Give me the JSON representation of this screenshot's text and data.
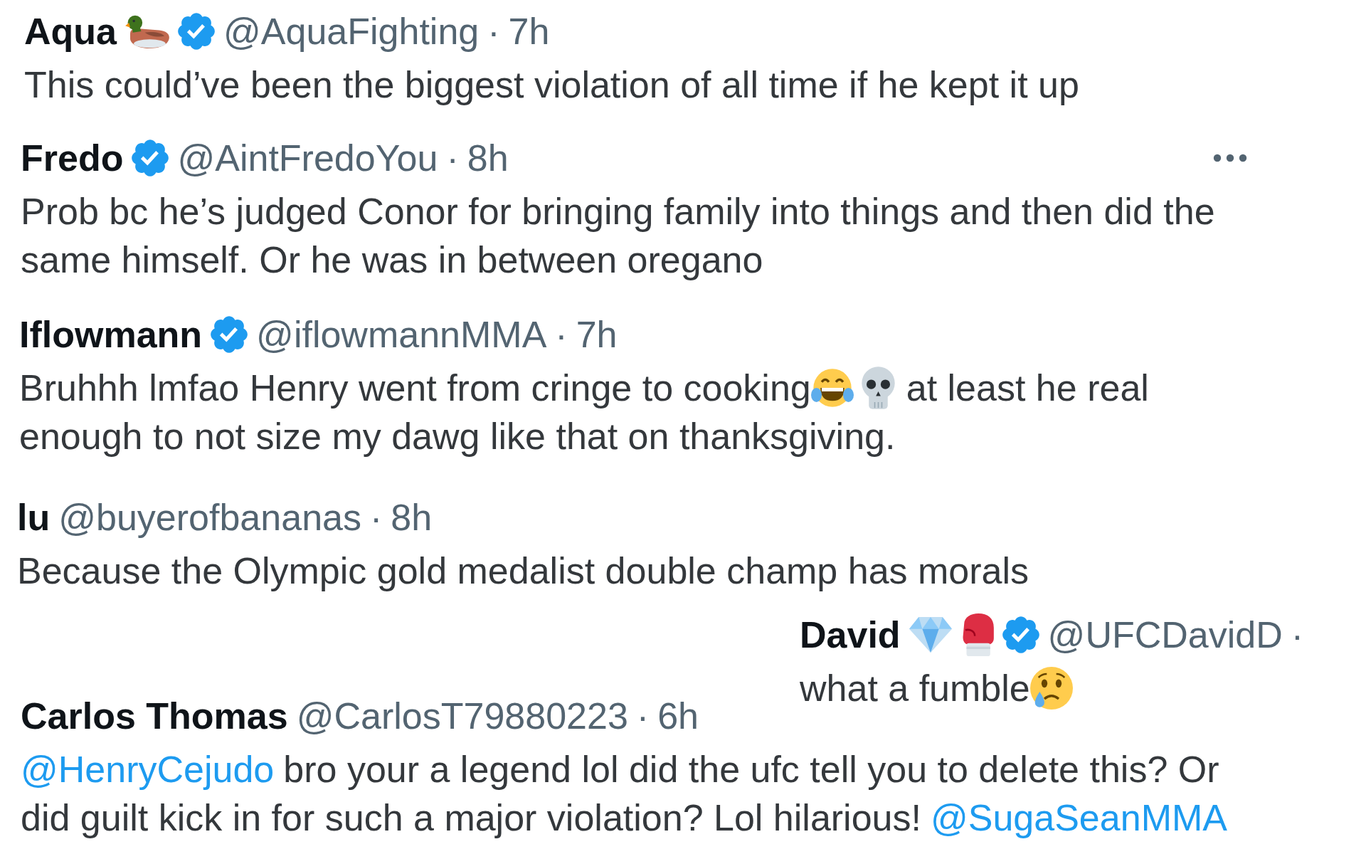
{
  "tweets": [
    {
      "name": "Aqua",
      "name_icons": [
        {
          "kind": "duck"
        }
      ],
      "verified": true,
      "handle": "@AquaFighting",
      "separator": "·",
      "time": "7h",
      "more_button": false,
      "lines": [
        [
          {
            "kind": "text",
            "text": "This could’ve been the biggest violation of all time if he kept it up"
          }
        ]
      ]
    },
    {
      "name": "Fredo",
      "verified": true,
      "handle": "@AintFredoYou",
      "separator": "·",
      "time": "8h",
      "more_button": true,
      "lines": [
        [
          {
            "kind": "text",
            "text": "Prob bc he’s judged Conor for bringing family into things and then did the"
          }
        ],
        [
          {
            "kind": "text",
            "text": "same himself. Or he was in between oregano"
          }
        ]
      ]
    },
    {
      "name": "Iflowmann",
      "verified": true,
      "handle": "@iflowmannMMA",
      "separator": "·",
      "time": "7h",
      "more_button": false,
      "lines": [
        [
          {
            "kind": "text",
            "text": "Bruhhh lmfao Henry went from cringe to cooking"
          },
          {
            "kind": "laughing"
          },
          {
            "kind": "skull"
          },
          {
            "kind": "text",
            "text": "at least he real"
          }
        ],
        [
          {
            "kind": "text",
            "text": "enough to not size my dawg like that on thanksgiving."
          }
        ]
      ]
    },
    {
      "name": "lu",
      "verified": false,
      "handle": "@buyerofbananas",
      "separator": "·",
      "time": "8h",
      "more_button": false,
      "lines": [
        [
          {
            "kind": "text",
            "text": "Because the Olympic gold medalist double champ has morals"
          }
        ]
      ]
    },
    {
      "name": "David",
      "name_icons": [
        {
          "kind": "gem"
        },
        {
          "kind": "glove"
        }
      ],
      "verified": true,
      "handle": "@UFCDavidD",
      "separator": "·",
      "more_button": false,
      "lines": [
        [
          {
            "kind": "text",
            "text": "what a fumble"
          },
          {
            "kind": "crying"
          }
        ]
      ]
    },
    {
      "name": "Carlos Thomas",
      "verified": false,
      "handle": "@CarlosT79880223",
      "separator": "·",
      "time": "6h",
      "more_button": false,
      "lines": [
        [
          {
            "kind": "link",
            "text": "@HenryCejudo"
          },
          {
            "kind": "text",
            "text": "bro your a legend lol did the ufc tell you to delete this? Or"
          }
        ],
        [
          {
            "kind": "text",
            "text": "did guilt kick in for such a major violation? Lol hilarious!"
          },
          {
            "kind": "link",
            "text": "@SugaSeanMMA"
          }
        ]
      ]
    }
  ]
}
